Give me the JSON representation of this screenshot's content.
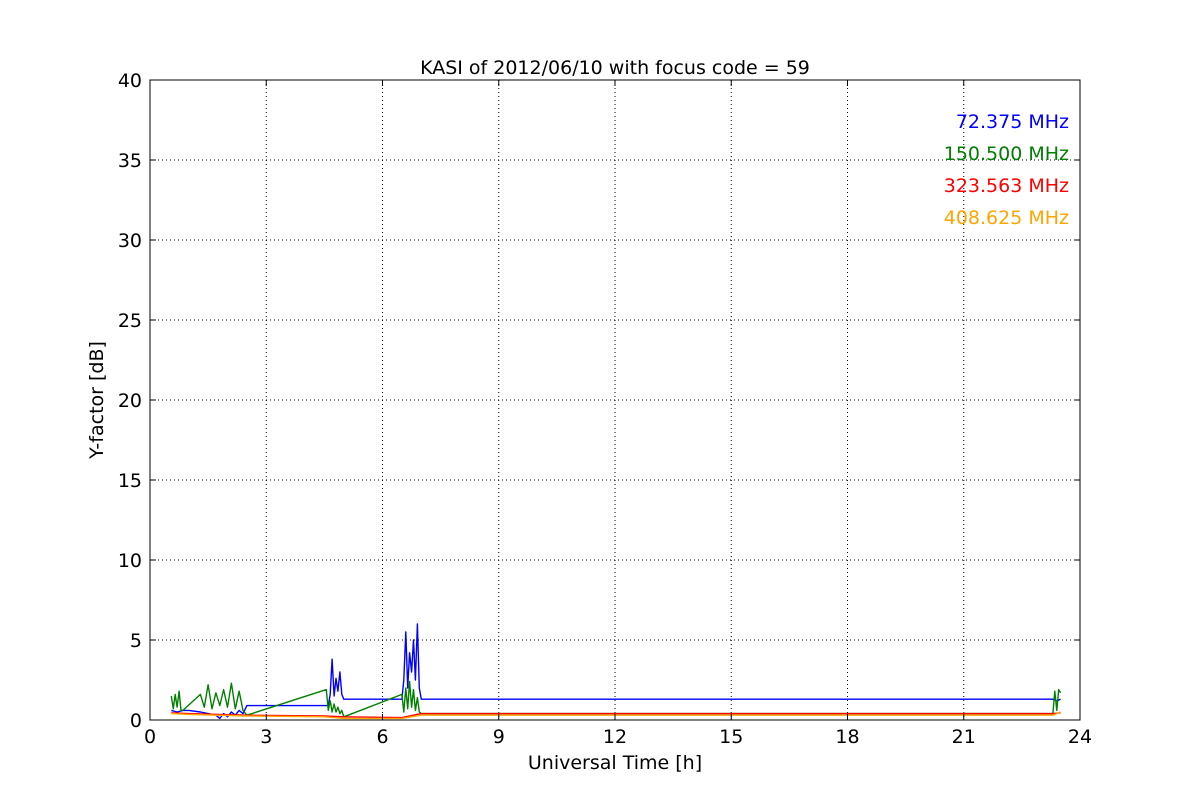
{
  "chart_data": {
    "type": "line",
    "title": "KASI of 2012/06/10 with focus code = 59",
    "xlabel": "Universal Time [h]",
    "ylabel": "Y-factor [dB]",
    "xlim": [
      0,
      24
    ],
    "ylim": [
      0,
      40
    ],
    "xticks": [
      0,
      3,
      6,
      9,
      12,
      15,
      18,
      21,
      24
    ],
    "yticks": [
      0,
      5,
      10,
      15,
      20,
      25,
      30,
      35,
      40
    ],
    "grid": true,
    "legend_placement": "top-right",
    "series": [
      {
        "name": "72.375 MHz",
        "color": "#0000ff",
        "x": [
          0.55,
          0.7,
          0.85,
          1.0,
          1.3,
          1.5,
          1.7,
          1.8,
          1.9,
          2.0,
          2.1,
          2.2,
          2.3,
          2.4,
          2.5,
          4.6,
          4.65,
          4.7,
          4.75,
          4.8,
          4.85,
          4.9,
          4.95,
          5.0,
          6.5,
          6.55,
          6.6,
          6.65,
          6.7,
          6.75,
          6.8,
          6.85,
          6.9,
          6.95,
          7.0,
          23.3,
          23.4,
          23.5
        ],
        "y": [
          0.6,
          0.5,
          0.6,
          0.6,
          0.5,
          0.4,
          0.3,
          0.1,
          0.4,
          0.2,
          0.5,
          0.3,
          0.6,
          0.4,
          0.9,
          0.9,
          1.6,
          3.8,
          1.5,
          2.6,
          1.8,
          3.0,
          1.6,
          1.3,
          1.3,
          2.5,
          5.5,
          2.0,
          4.2,
          3.0,
          5.0,
          2.5,
          6.0,
          2.0,
          1.3,
          1.3,
          1.2,
          1.3
        ]
      },
      {
        "name": "150.500 MHz",
        "color": "#008000",
        "x": [
          0.55,
          0.6,
          0.65,
          0.7,
          0.75,
          0.8,
          0.85,
          1.3,
          1.4,
          1.5,
          1.6,
          1.7,
          1.8,
          1.9,
          2.0,
          2.1,
          2.2,
          2.3,
          2.4,
          2.5,
          4.55,
          4.6,
          4.65,
          4.7,
          4.75,
          4.8,
          4.85,
          4.9,
          4.95,
          5.0,
          6.5,
          6.55,
          6.6,
          6.65,
          6.7,
          6.75,
          6.8,
          6.85,
          6.9,
          6.95,
          7.0,
          23.3,
          23.35,
          23.4,
          23.45,
          23.5
        ],
        "y": [
          1.5,
          0.7,
          1.6,
          0.8,
          1.8,
          0.6,
          0.6,
          1.6,
          0.8,
          2.2,
          0.7,
          1.7,
          0.9,
          1.9,
          0.8,
          2.3,
          0.7,
          1.8,
          0.6,
          0.3,
          1.9,
          0.6,
          1.2,
          0.5,
          1.0,
          0.5,
          0.8,
          0.4,
          0.6,
          0.2,
          1.6,
          0.5,
          2.0,
          0.7,
          2.4,
          0.8,
          1.9,
          0.6,
          1.4,
          0.5,
          0.4,
          0.4,
          1.8,
          0.6,
          1.9,
          1.7
        ]
      },
      {
        "name": "323.563 MHz",
        "color": "#ff0000",
        "x": [
          0.55,
          1.0,
          2.5,
          4.5,
          5.0,
          6.5,
          7.0,
          23.3,
          23.5
        ],
        "y": [
          0.45,
          0.4,
          0.3,
          0.25,
          0.2,
          0.15,
          0.4,
          0.4,
          0.45
        ]
      },
      {
        "name": "408.625 MHz",
        "color": "#ffa500",
        "x": [
          0.55,
          1.0,
          2.5,
          4.5,
          5.0,
          6.5,
          7.0,
          23.3,
          23.5
        ],
        "y": [
          0.4,
          0.35,
          0.25,
          0.2,
          0.1,
          0.1,
          0.3,
          0.3,
          0.5
        ]
      }
    ]
  }
}
